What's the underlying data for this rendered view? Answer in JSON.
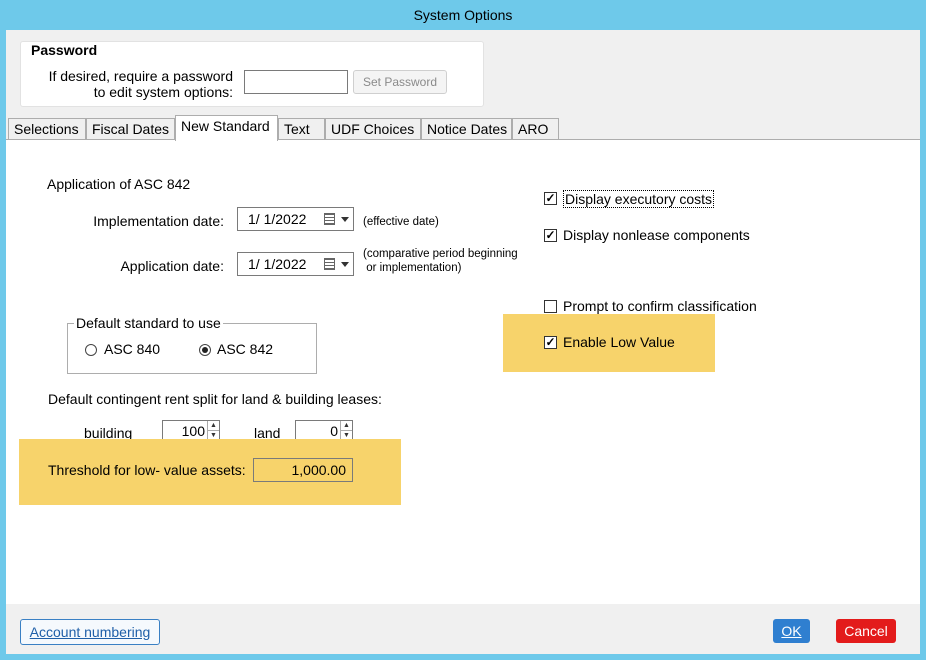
{
  "window": {
    "title": "System Options"
  },
  "password": {
    "group_title": "Password",
    "label_line1": "If desired, require a password",
    "label_line2": "to edit system options:",
    "value": "",
    "set_button": "Set Password"
  },
  "tabs": [
    {
      "label": "Selections",
      "active": false
    },
    {
      "label": "Fiscal Dates",
      "active": false
    },
    {
      "label": "New Standard",
      "active": true
    },
    {
      "label": "Text",
      "active": false
    },
    {
      "label": "UDF Choices",
      "active": false
    },
    {
      "label": "Notice Dates",
      "active": false
    },
    {
      "label": "ARO",
      "active": false
    }
  ],
  "new_standard": {
    "section_label": "Application of ASC 842",
    "implementation_date": {
      "label": "Implementation date:",
      "value": "1/  1/2022",
      "note": "(effective date)"
    },
    "application_date": {
      "label": "Application date:",
      "value": "1/  1/2022",
      "note_line1": "(comparative period beginning",
      "note_line2": " or implementation)"
    },
    "default_standard": {
      "title": "Default standard to use",
      "options": [
        {
          "label": "ASC 840",
          "selected": false
        },
        {
          "label": "ASC 842",
          "selected": true
        }
      ]
    },
    "contingent_split": {
      "label": "Default contingent rent split for land & building leases:",
      "building_label": "building",
      "building_value": "100",
      "land_label": "land",
      "land_value": "0"
    },
    "threshold": {
      "label": "Threshold for low- value assets:",
      "value": "1,000.00"
    },
    "checkboxes": [
      {
        "label": "Display executory costs",
        "checked": true
      },
      {
        "label": "Display nonlease components",
        "checked": true
      },
      {
        "label": "Prompt to confirm classification",
        "checked": false
      },
      {
        "label": "Enable Low Value",
        "checked": true
      }
    ],
    "highlight_color": "#f7d36b"
  },
  "footer": {
    "account_button": "Account numbering",
    "ok_button": "OK",
    "cancel_button": "Cancel",
    "ok_color": "#2f7fd0",
    "cancel_color": "#e31b1b"
  }
}
